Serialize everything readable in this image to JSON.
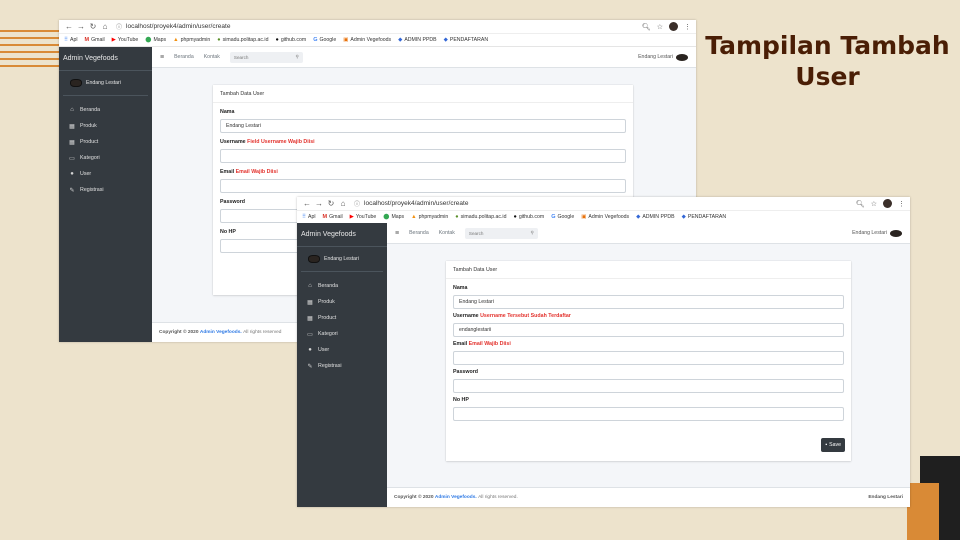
{
  "slide": {
    "title": "Tampilan Tambah User",
    "colors": {
      "background": "#ede3cc",
      "accent": "#d98a36",
      "title": "#4a1e05",
      "dark": "#1f1f1f"
    }
  },
  "browser": {
    "back_icon": "arrow-left-icon",
    "forward_icon": "arrow-right-icon",
    "reload_icon": "reload-icon",
    "home_icon": "home-icon",
    "url": "localhost/proyek4/admin/user/create",
    "bookmarks": [
      "Apl",
      "Gmail",
      "YouTube",
      "Maps",
      "phpmyadmin",
      "simadu.politap.ac.id",
      "github.com",
      "Google",
      "Admin Vegefoods",
      "ADMIN PPDB",
      "PENDAFTARAN"
    ]
  },
  "app": {
    "brand": "Admin Vegefoods",
    "user_name": "Endang Lestari",
    "menu": [
      "Beranda",
      "Produk",
      "Product",
      "Kategori",
      "User",
      "Registrasi"
    ],
    "topnav": {
      "links": [
        "Beranda",
        "Kontak"
      ],
      "search_placeholder": "Search",
      "user": "Endang Lestari"
    },
    "colors": {
      "sidebar": "#343a40",
      "error": "#e3342f",
      "link": "#2f7ae5"
    }
  },
  "form1": {
    "card_title": "Tambah Data User",
    "nama_label": "Nama",
    "nama_value": "Endang Lestari",
    "username_label": "Username",
    "username_error": "Field Username Wajib Diisi",
    "username_value": "",
    "email_label": "Email",
    "email_error": "Email Wajib Diisi",
    "password_label": "Password",
    "nohp_label": "No HP",
    "footer_copyright": "Copyright © 2020",
    "footer_link": "Admin Vegefoods.",
    "footer_rights": "All rights reserved"
  },
  "form2": {
    "card_title": "Tambah Data User",
    "nama_label": "Nama",
    "nama_value": "Endang Lestari",
    "username_label": "Username",
    "username_error": "Username Tersebut Sudah Terdaftar",
    "username_value": "endanglestarii",
    "email_label": "Email",
    "email_error": "Email Wajib Diisi",
    "password_label": "Password",
    "nohp_label": "No HP",
    "save_label": "Save",
    "footer_copyright": "Copyright © 2020",
    "footer_link": "Admin Vegefoods.",
    "footer_rights": "All rights reserved.",
    "footer_right": "Endang Lestari"
  }
}
